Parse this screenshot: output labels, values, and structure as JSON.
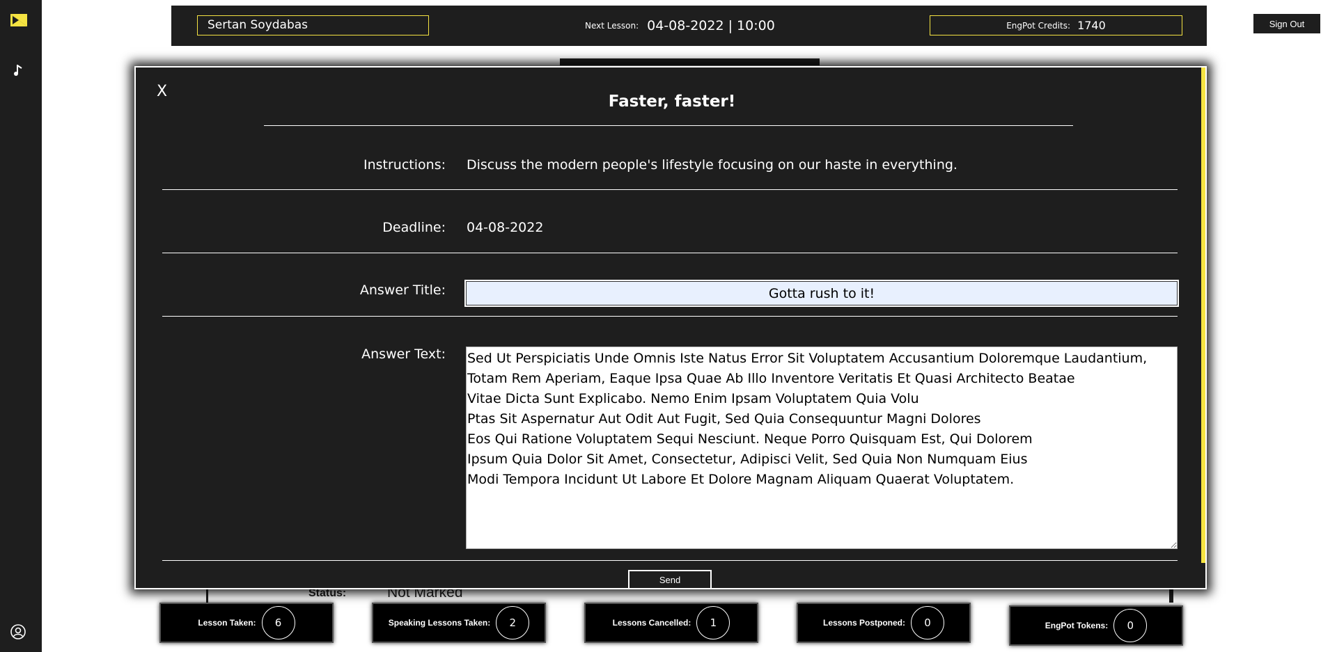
{
  "sidebar": {
    "logo_icon": "brand-logo-icon",
    "nav_icon": "music-note-icon",
    "profile_icon": "user-circle-icon",
    "accent_color": "#f5e342"
  },
  "header": {
    "user_name": "Sertan Soydabas",
    "next_lesson_label": "Next Lesson:",
    "next_lesson_value": "04-08-2022 | 10:00",
    "credits_label": "EngPot Credits:",
    "credits_value": "1740"
  },
  "sign_out_label": "Sign Out",
  "background": {
    "status_label": "Status:",
    "status_value": "Not Marked"
  },
  "stats": [
    {
      "label": "Lesson Taken:",
      "value": "6"
    },
    {
      "label": "Speaking Lessons Taken:",
      "value": "2"
    },
    {
      "label": "Lessons Cancelled:",
      "value": "1"
    },
    {
      "label": "Lessons Postponed:",
      "value": "0"
    },
    {
      "label": "EngPot Tokens:",
      "value": "0"
    }
  ],
  "modal": {
    "close_label": "X",
    "title": "Faster, faster!",
    "instructions_label": "Instructions:",
    "instructions_value": "Discuss the modern people's lifestyle focusing on our haste in everything.",
    "deadline_label": "Deadline:",
    "deadline_value": "04-08-2022",
    "answer_title_label": "Answer Title:",
    "answer_title_value": "Gotta rush to it!",
    "answer_text_label": "Answer Text:",
    "answer_text_value": "Sed Ut Perspiciatis Unde Omnis Iste Natus Error Sit Voluptatem Accusantium Doloremque Laudantium,\nTotam Rem Aperiam, Eaque Ipsa Quae Ab Illo Inventore Veritatis Et Quasi Architecto Beatae\nVitae Dicta Sunt Explicabo. Nemo Enim Ipsam Voluptatem Quia Volu\nPtas Sit Aspernatur Aut Odit Aut Fugit, Sed Quia Consequuntur Magni Dolores\nEos Qui Ratione Voluptatem Sequi Nesciunt. Neque Porro Quisquam Est, Qui Dolorem\nIpsum Quia Dolor Sit Amet, Consectetur, Adipisci Velit, Sed Quia Non Numquam Eius\nModi Tempora Incidunt Ut Labore Et Dolore Magnam Aliquam Quaerat Voluptatem.",
    "send_label": "Send"
  }
}
